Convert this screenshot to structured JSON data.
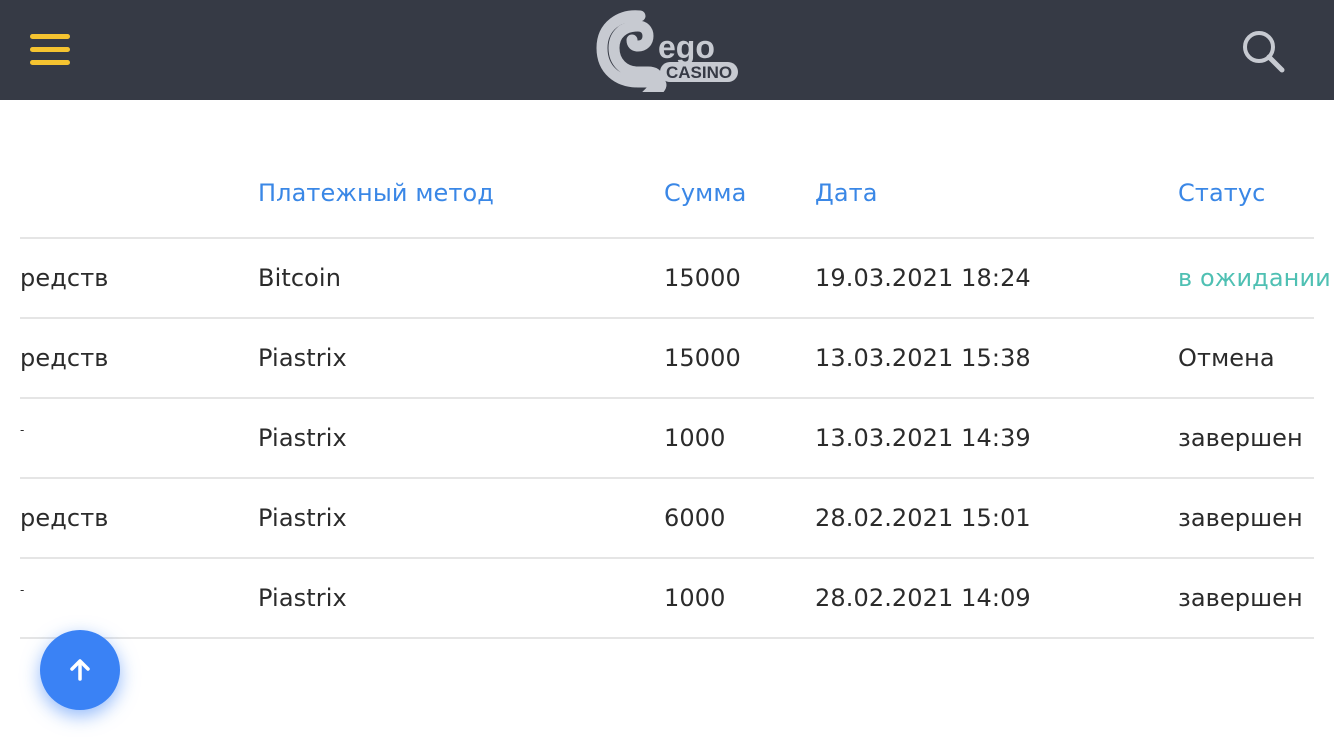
{
  "header": {
    "logo_main": "ego",
    "logo_sub": "CASINO"
  },
  "table": {
    "columns": [
      "",
      "Платежный метод",
      "Сумма",
      "Дата",
      "Статус"
    ],
    "rows": [
      {
        "type": "редств",
        "method": "Bitcoin",
        "amount": "15000",
        "date": "19.03.2021 18:24",
        "status": "в ожидании",
        "pending": true
      },
      {
        "type": "редств",
        "method": "Piastrix",
        "amount": "15000",
        "date": "13.03.2021 15:38",
        "status": "Отмена",
        "pending": false
      },
      {
        "type": "-",
        "method": "Piastrix",
        "amount": "1000",
        "date": "13.03.2021 14:39",
        "status": "завершен",
        "pending": false
      },
      {
        "type": "редств",
        "method": "Piastrix",
        "amount": "6000",
        "date": "28.02.2021 15:01",
        "status": "завершен",
        "pending": false
      },
      {
        "type": "-",
        "method": "Piastrix",
        "amount": "1000",
        "date": "28.02.2021 14:09",
        "status": "завершен",
        "pending": false
      }
    ]
  },
  "colors": {
    "topbar": "#363a45",
    "accent_yellow": "#f5c330",
    "header_blue": "#3a87e6",
    "pending_teal": "#4fc0b3",
    "fab_blue": "#3a82f5"
  },
  "icons": {
    "menu": "hamburger-icon",
    "search": "search-icon",
    "scroll_top": "arrow-up-icon"
  }
}
